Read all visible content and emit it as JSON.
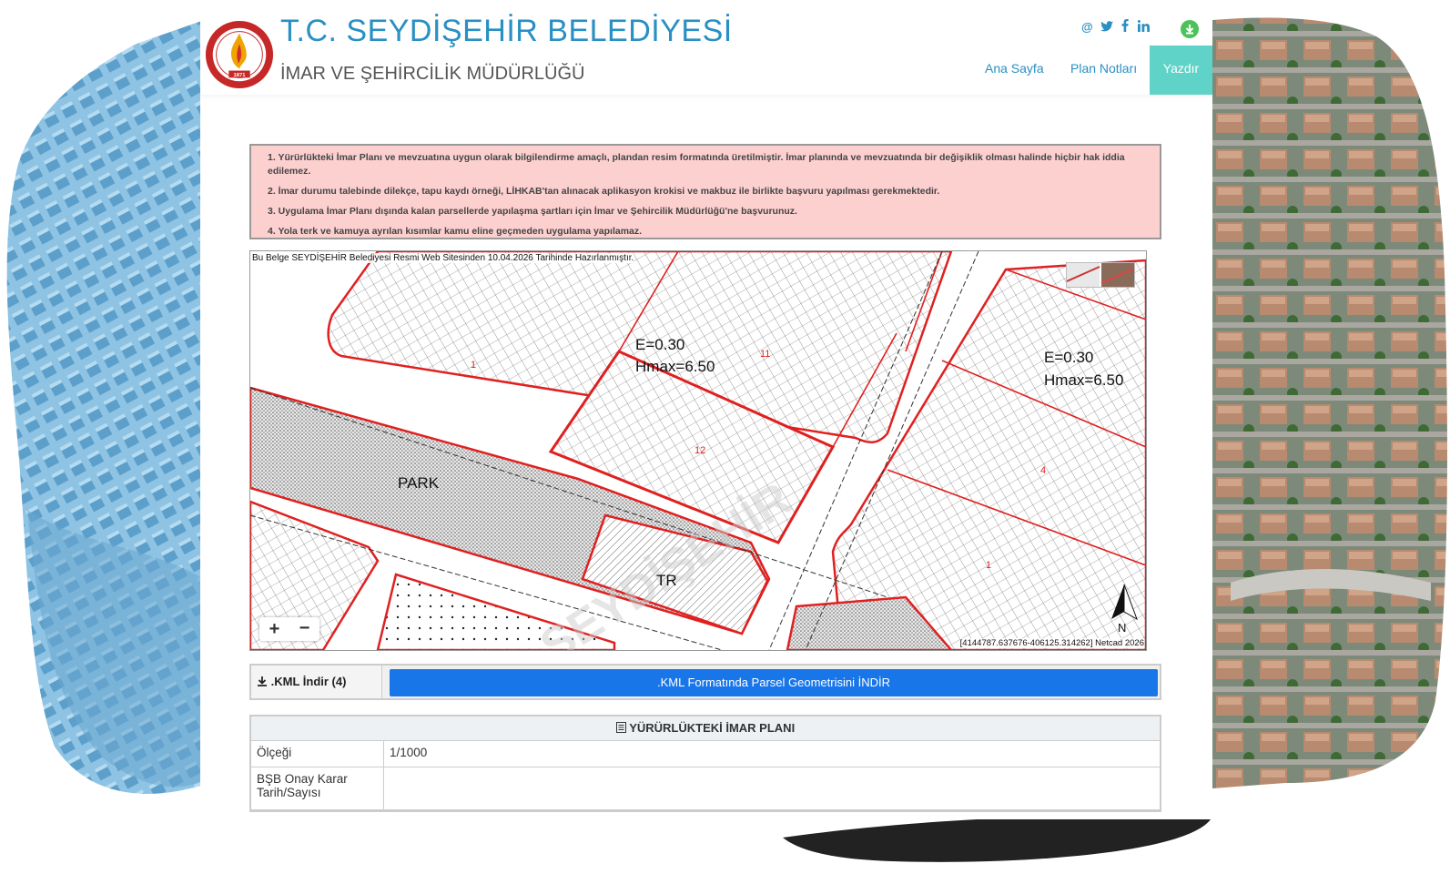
{
  "header": {
    "title": "T.C. SEYDİŞEHİR BELEDİYESİ",
    "subtitle": "İMAR VE ŞEHİRCİLİK MÜDÜRLÜĞÜ",
    "logo_year": "1871",
    "social": [
      "@",
      "twitter-icon",
      "facebook-icon",
      "linkedin-icon"
    ],
    "nav": {
      "home": "Ana Sayfa",
      "plan_notes": "Plan Notları",
      "print": "Yazdır"
    }
  },
  "notices": [
    "1. Yürürlükteki İmar Planı ve mevzuatına uygun olarak bilgilendirme amaçlı, plandan resim formatında üretilmiştir. İmar planında ve mevzuatında bir değişiklik olması halinde hiçbir hak iddia edilemez.",
    "2. İmar durumu talebinde dilekçe, tapu kaydı örneği, LİHKAB'tan alınacak aplikasyon krokisi ve makbuz ile birlikte başvuru yapılması gerekmektedir.",
    "3. Uygulama İmar Planı dışında kalan parsellerde yapılaşma şartları için İmar ve Şehircilik Müdürlüğü'ne başvurunuz.",
    "4. Yola terk ve kamuya ayrılan kısımlar kamu eline geçmeden uygulama yapılamaz."
  ],
  "map": {
    "stamp": "Bu Belge SEYDİŞEHİR Belediyesi Resmi Web Sitesinden 10.04.2026 Tarihinde Hazırlanmıştır.",
    "coords": "[4144787.637676-406125.314262] Netcad 2026",
    "labels": {
      "e1": "E=0.30",
      "h1": "Hmax=6.50",
      "e2": "E=0.30",
      "h2": "Hmax=6.50",
      "park": "PARK",
      "tr": "TR",
      "north": "N",
      "p12": "12",
      "p11": "11",
      "p1": "1",
      "p4": "4",
      "p1b": "1"
    },
    "zoom_in": "+",
    "zoom_out": "−"
  },
  "kml": {
    "label": ".KML İndir (4)",
    "button": ".KML Formatında Parsel Geometrisini İNDİR"
  },
  "plan_table": {
    "header": "YÜRÜRLÜKTEKİ İMAR PLANI",
    "rows": [
      {
        "key": "Ölçeği",
        "value": "1/1000"
      },
      {
        "key": "BŞB Onay Karar Tarih/Sayısı",
        "value": ""
      }
    ]
  },
  "colors": {
    "title": "#2a8fc3",
    "print_tab": "#5fd3c8",
    "kml_button": "#1976e8",
    "notice_bg": "#fdd0d0",
    "plan_line": "#e02020"
  }
}
